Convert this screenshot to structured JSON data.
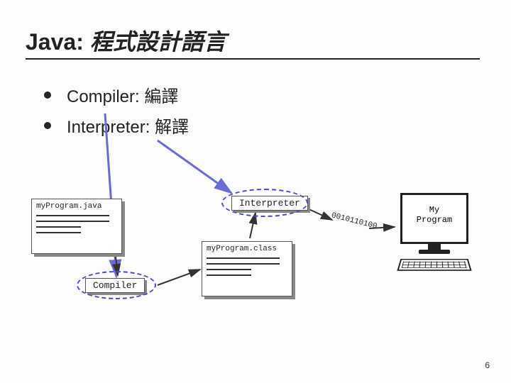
{
  "title": {
    "en": "Java:",
    "cn": "程式設計語言"
  },
  "bullets": [
    {
      "label": "Compiler: 編譯"
    },
    {
      "label": "Interpreter: 解譯"
    }
  ],
  "diagram": {
    "source_file": "myProgram.java",
    "compiled_file": "myProgram.class",
    "compiler_label": "Compiler",
    "interpreter_label": "Interpreter",
    "binary_stream": "0010110100",
    "output_line1": "My",
    "output_line2": "Program"
  },
  "page_number": "6"
}
